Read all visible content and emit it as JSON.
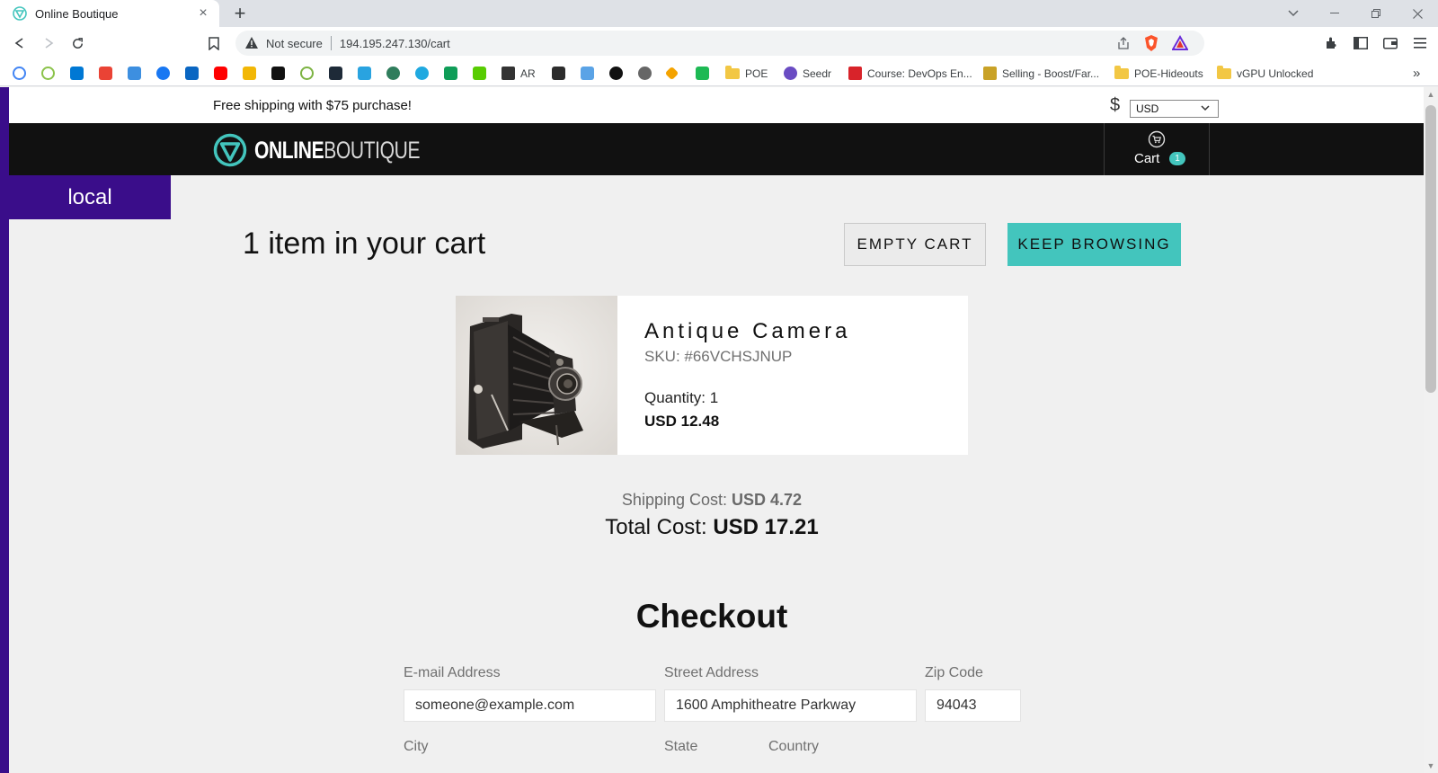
{
  "browser": {
    "tab_title": "Online Boutique",
    "new_tab": "+",
    "close_tab": "×",
    "not_secure": "Not secure",
    "url": "194.195.247.130/cart",
    "bookmarks": {
      "ar": "AR",
      "poe": "POE",
      "seedr": "Seedr",
      "course": "Course: DevOps En...",
      "selling": "Selling - Boost/Far...",
      "poe_hideouts": "POE-Hideouts",
      "vgpu": "vGPU Unlocked",
      "more": "»"
    }
  },
  "header": {
    "shipping_message": "Free shipping with $75 purchase!",
    "currency_symbol": "$",
    "currency_selected": "USD",
    "logo_bold": "ONLINE",
    "logo_light": "BOUTIQUE",
    "cart_label": "Cart",
    "cart_count": "1"
  },
  "env_badge": "local",
  "cart": {
    "title": "1 item in your cart",
    "empty_button": "EMPTY CART",
    "keep_browsing_button": "KEEP BROWSING",
    "items": [
      {
        "name": "Antique Camera",
        "sku": "SKU: #66VCHSJNUP",
        "quantity": "Quantity: 1",
        "price": "USD 12.48"
      }
    ],
    "shipping_label": "Shipping Cost:",
    "shipping_value": "USD 4.72",
    "total_label": "Total Cost:",
    "total_value": "USD 17.21"
  },
  "checkout": {
    "title": "Checkout",
    "email_label": "E-mail Address",
    "email_value": "someone@example.com",
    "street_label": "Street Address",
    "street_value": "1600 Amphitheatre Parkway",
    "zip_label": "Zip Code",
    "zip_value": "94043",
    "city_label": "City",
    "state_label": "State",
    "country_label": "Country"
  },
  "colors": {
    "accent_teal": "#43c5bd",
    "navbar_black": "#111111",
    "env_purple": "#3a0d8a"
  }
}
